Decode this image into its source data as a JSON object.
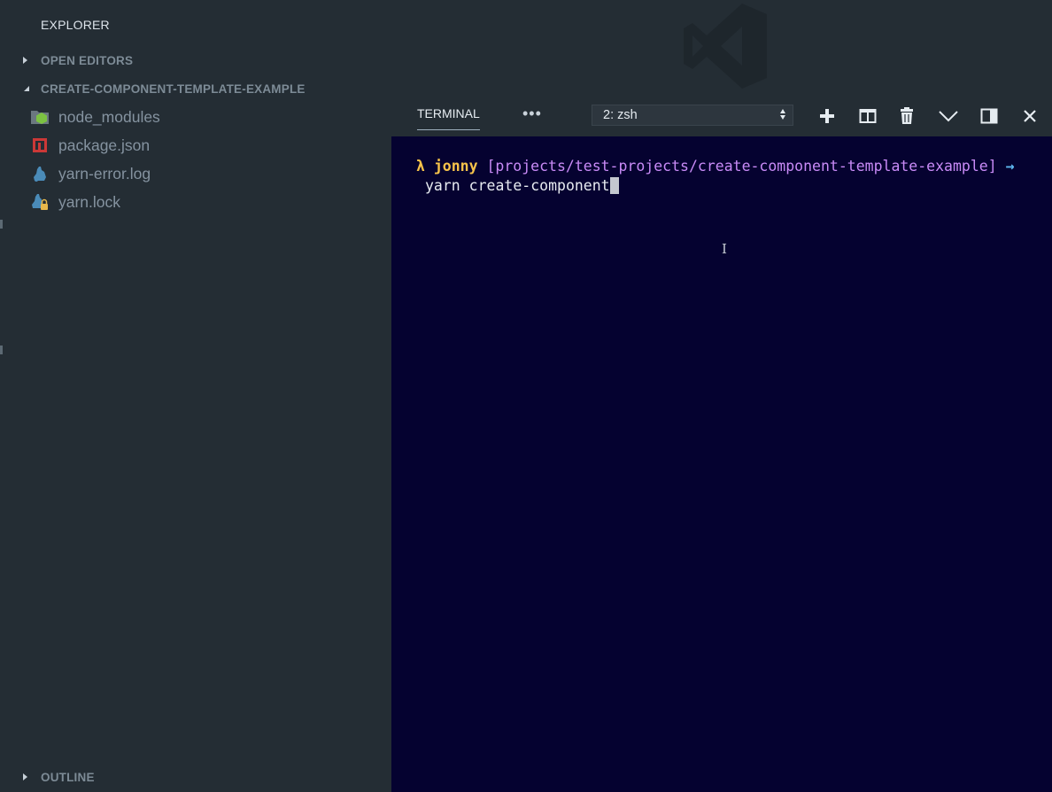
{
  "sidebar": {
    "title": "EXPLORER",
    "sections": {
      "open_editors": "OPEN EDITORS",
      "project": "CREATE-COMPONENT-TEMPLATE-EXAMPLE",
      "outline": "OUTLINE"
    },
    "files": [
      {
        "name": "node_modules",
        "icon": "node-folder-icon"
      },
      {
        "name": "package.json",
        "icon": "npm-package-icon"
      },
      {
        "name": "yarn-error.log",
        "icon": "yarn-icon"
      },
      {
        "name": "yarn.lock",
        "icon": "yarn-lock-icon"
      }
    ]
  },
  "panel": {
    "tab_label": "TERMINAL",
    "more_label": "•••",
    "shell_selected": "2: zsh",
    "icons": [
      "add-terminal-icon",
      "split-terminal-icon",
      "kill-terminal-icon",
      "collapse-panel-icon",
      "toggle-panel-layout-icon",
      "close-panel-icon"
    ]
  },
  "terminal": {
    "prompt_symbol": "λ",
    "user": "jonny",
    "cwd": "[projects/test-projects/create-component-template-example]",
    "arrow": "→",
    "command": "yarn create-component"
  },
  "colors": {
    "sidebar_bg": "#242d34",
    "terminal_bg": "#050230",
    "prompt_user": "#f7c34a",
    "prompt_path": "#c98bf7",
    "prompt_arrow": "#5fb8f0"
  }
}
